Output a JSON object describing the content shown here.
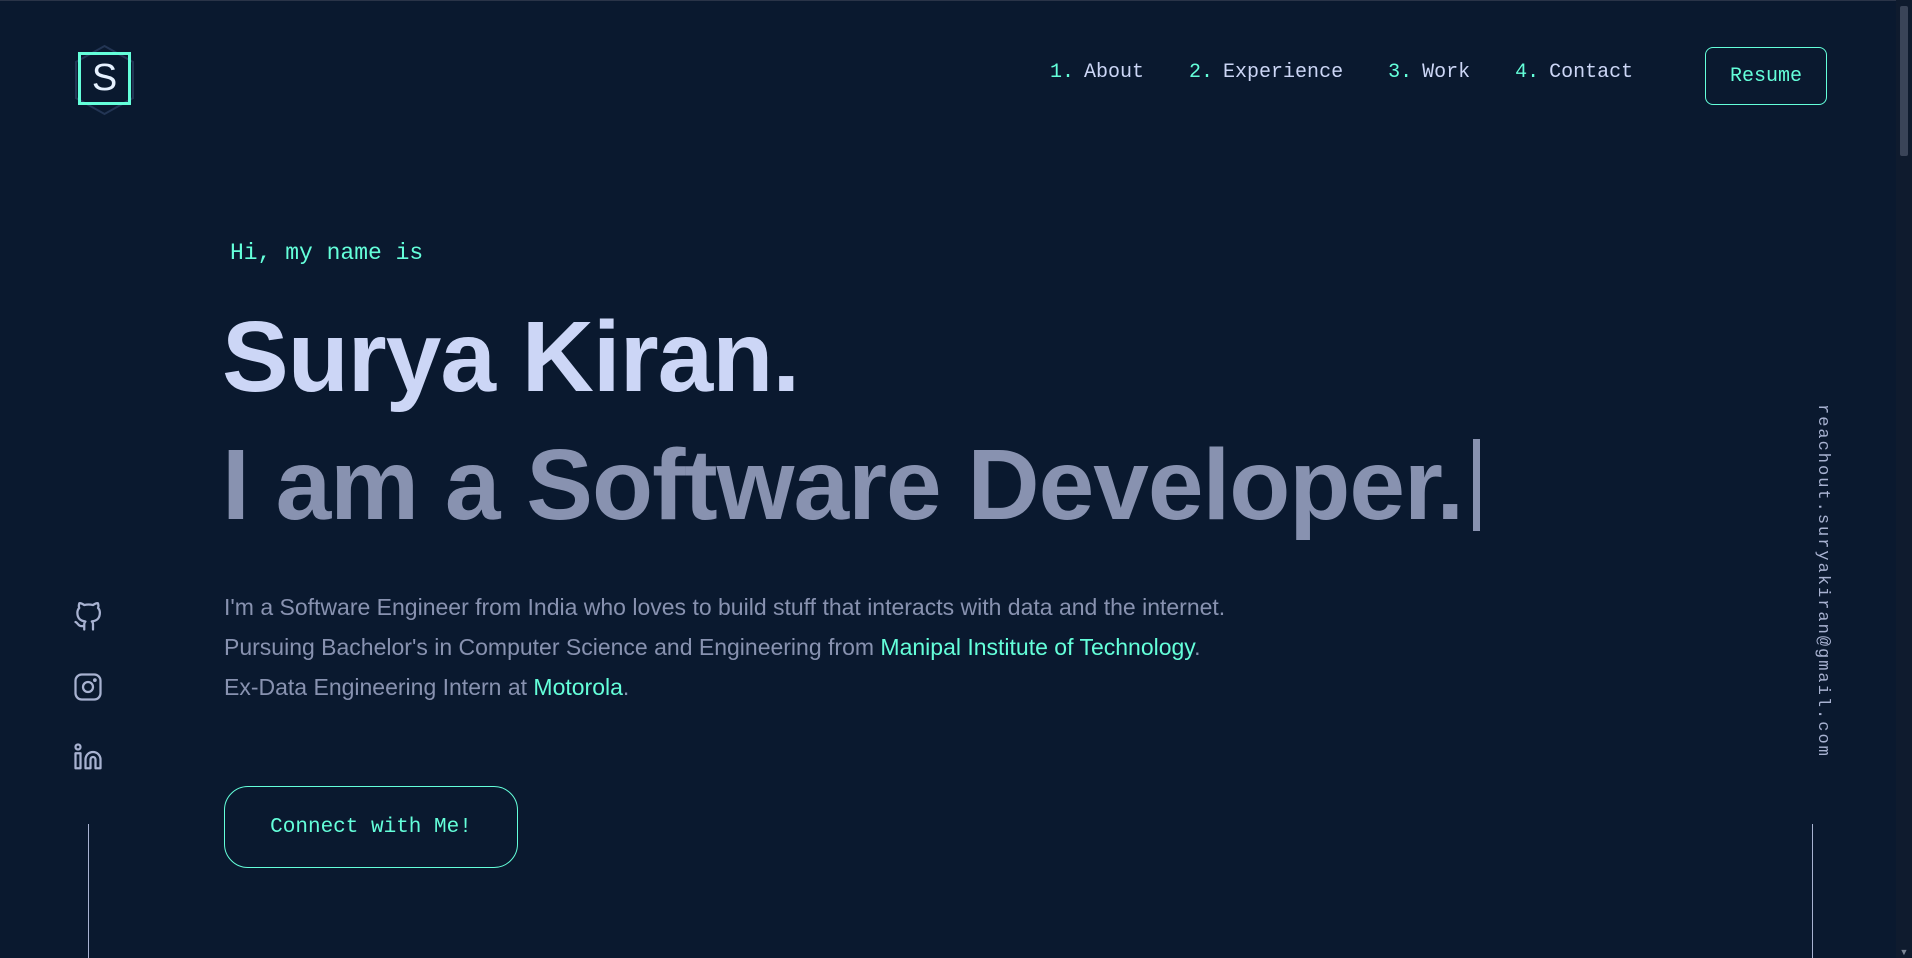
{
  "logo": {
    "letter": "S"
  },
  "nav": {
    "items": [
      {
        "num": "1.",
        "label": "About"
      },
      {
        "num": "2.",
        "label": "Experience"
      },
      {
        "num": "3.",
        "label": "Work"
      },
      {
        "num": "4.",
        "label": "Contact"
      }
    ],
    "resume_label": "Resume"
  },
  "hero": {
    "greeting": "Hi, my name is",
    "name": "Surya Kiran.",
    "tagline": "I am a Software Developer.",
    "desc_line1": "I'm a Software Engineer from India who loves to build stuff that interacts with data and the internet.",
    "desc_line2_prefix": "Pursuing Bachelor's in Computer Science and Engineering from ",
    "desc_line2_link": "Manipal Institute of Technology",
    "desc_line2_suffix": ".",
    "desc_line3_prefix": "Ex-Data Engineering Intern at ",
    "desc_line3_link": "Motorola",
    "desc_line3_suffix": ".",
    "cta_label": "Connect with Me!"
  },
  "socials": [
    "github-icon",
    "instagram-icon",
    "linkedin-icon"
  ],
  "email": "reachout.suryakiran@gmail.com",
  "colors": {
    "background": "#0a192f",
    "accent": "#64ffda",
    "heading": "#ccd6f6",
    "body": "#8892b0"
  }
}
